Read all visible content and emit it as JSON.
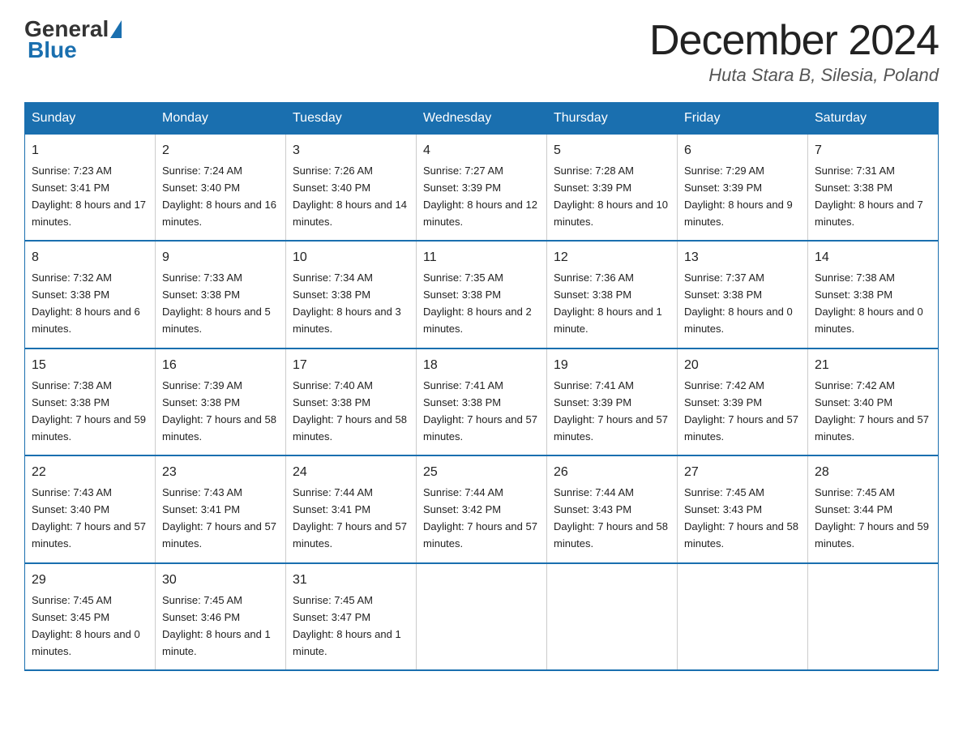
{
  "header": {
    "logo_general": "General",
    "logo_blue": "Blue",
    "month_title": "December 2024",
    "location": "Huta Stara B, Silesia, Poland"
  },
  "weekdays": [
    "Sunday",
    "Monday",
    "Tuesday",
    "Wednesday",
    "Thursday",
    "Friday",
    "Saturday"
  ],
  "weeks": [
    [
      {
        "day": "1",
        "sunrise": "7:23 AM",
        "sunset": "3:41 PM",
        "daylight": "8 hours and 17 minutes."
      },
      {
        "day": "2",
        "sunrise": "7:24 AM",
        "sunset": "3:40 PM",
        "daylight": "8 hours and 16 minutes."
      },
      {
        "day": "3",
        "sunrise": "7:26 AM",
        "sunset": "3:40 PM",
        "daylight": "8 hours and 14 minutes."
      },
      {
        "day": "4",
        "sunrise": "7:27 AM",
        "sunset": "3:39 PM",
        "daylight": "8 hours and 12 minutes."
      },
      {
        "day": "5",
        "sunrise": "7:28 AM",
        "sunset": "3:39 PM",
        "daylight": "8 hours and 10 minutes."
      },
      {
        "day": "6",
        "sunrise": "7:29 AM",
        "sunset": "3:39 PM",
        "daylight": "8 hours and 9 minutes."
      },
      {
        "day": "7",
        "sunrise": "7:31 AM",
        "sunset": "3:38 PM",
        "daylight": "8 hours and 7 minutes."
      }
    ],
    [
      {
        "day": "8",
        "sunrise": "7:32 AM",
        "sunset": "3:38 PM",
        "daylight": "8 hours and 6 minutes."
      },
      {
        "day": "9",
        "sunrise": "7:33 AM",
        "sunset": "3:38 PM",
        "daylight": "8 hours and 5 minutes."
      },
      {
        "day": "10",
        "sunrise": "7:34 AM",
        "sunset": "3:38 PM",
        "daylight": "8 hours and 3 minutes."
      },
      {
        "day": "11",
        "sunrise": "7:35 AM",
        "sunset": "3:38 PM",
        "daylight": "8 hours and 2 minutes."
      },
      {
        "day": "12",
        "sunrise": "7:36 AM",
        "sunset": "3:38 PM",
        "daylight": "8 hours and 1 minute."
      },
      {
        "day": "13",
        "sunrise": "7:37 AM",
        "sunset": "3:38 PM",
        "daylight": "8 hours and 0 minutes."
      },
      {
        "day": "14",
        "sunrise": "7:38 AM",
        "sunset": "3:38 PM",
        "daylight": "8 hours and 0 minutes."
      }
    ],
    [
      {
        "day": "15",
        "sunrise": "7:38 AM",
        "sunset": "3:38 PM",
        "daylight": "7 hours and 59 minutes."
      },
      {
        "day": "16",
        "sunrise": "7:39 AM",
        "sunset": "3:38 PM",
        "daylight": "7 hours and 58 minutes."
      },
      {
        "day": "17",
        "sunrise": "7:40 AM",
        "sunset": "3:38 PM",
        "daylight": "7 hours and 58 minutes."
      },
      {
        "day": "18",
        "sunrise": "7:41 AM",
        "sunset": "3:38 PM",
        "daylight": "7 hours and 57 minutes."
      },
      {
        "day": "19",
        "sunrise": "7:41 AM",
        "sunset": "3:39 PM",
        "daylight": "7 hours and 57 minutes."
      },
      {
        "day": "20",
        "sunrise": "7:42 AM",
        "sunset": "3:39 PM",
        "daylight": "7 hours and 57 minutes."
      },
      {
        "day": "21",
        "sunrise": "7:42 AM",
        "sunset": "3:40 PM",
        "daylight": "7 hours and 57 minutes."
      }
    ],
    [
      {
        "day": "22",
        "sunrise": "7:43 AM",
        "sunset": "3:40 PM",
        "daylight": "7 hours and 57 minutes."
      },
      {
        "day": "23",
        "sunrise": "7:43 AM",
        "sunset": "3:41 PM",
        "daylight": "7 hours and 57 minutes."
      },
      {
        "day": "24",
        "sunrise": "7:44 AM",
        "sunset": "3:41 PM",
        "daylight": "7 hours and 57 minutes."
      },
      {
        "day": "25",
        "sunrise": "7:44 AM",
        "sunset": "3:42 PM",
        "daylight": "7 hours and 57 minutes."
      },
      {
        "day": "26",
        "sunrise": "7:44 AM",
        "sunset": "3:43 PM",
        "daylight": "7 hours and 58 minutes."
      },
      {
        "day": "27",
        "sunrise": "7:45 AM",
        "sunset": "3:43 PM",
        "daylight": "7 hours and 58 minutes."
      },
      {
        "day": "28",
        "sunrise": "7:45 AM",
        "sunset": "3:44 PM",
        "daylight": "7 hours and 59 minutes."
      }
    ],
    [
      {
        "day": "29",
        "sunrise": "7:45 AM",
        "sunset": "3:45 PM",
        "daylight": "8 hours and 0 minutes."
      },
      {
        "day": "30",
        "sunrise": "7:45 AM",
        "sunset": "3:46 PM",
        "daylight": "8 hours and 1 minute."
      },
      {
        "day": "31",
        "sunrise": "7:45 AM",
        "sunset": "3:47 PM",
        "daylight": "8 hours and 1 minute."
      },
      null,
      null,
      null,
      null
    ]
  ],
  "labels": {
    "sunrise": "Sunrise:",
    "sunset": "Sunset:",
    "daylight": "Daylight:"
  }
}
